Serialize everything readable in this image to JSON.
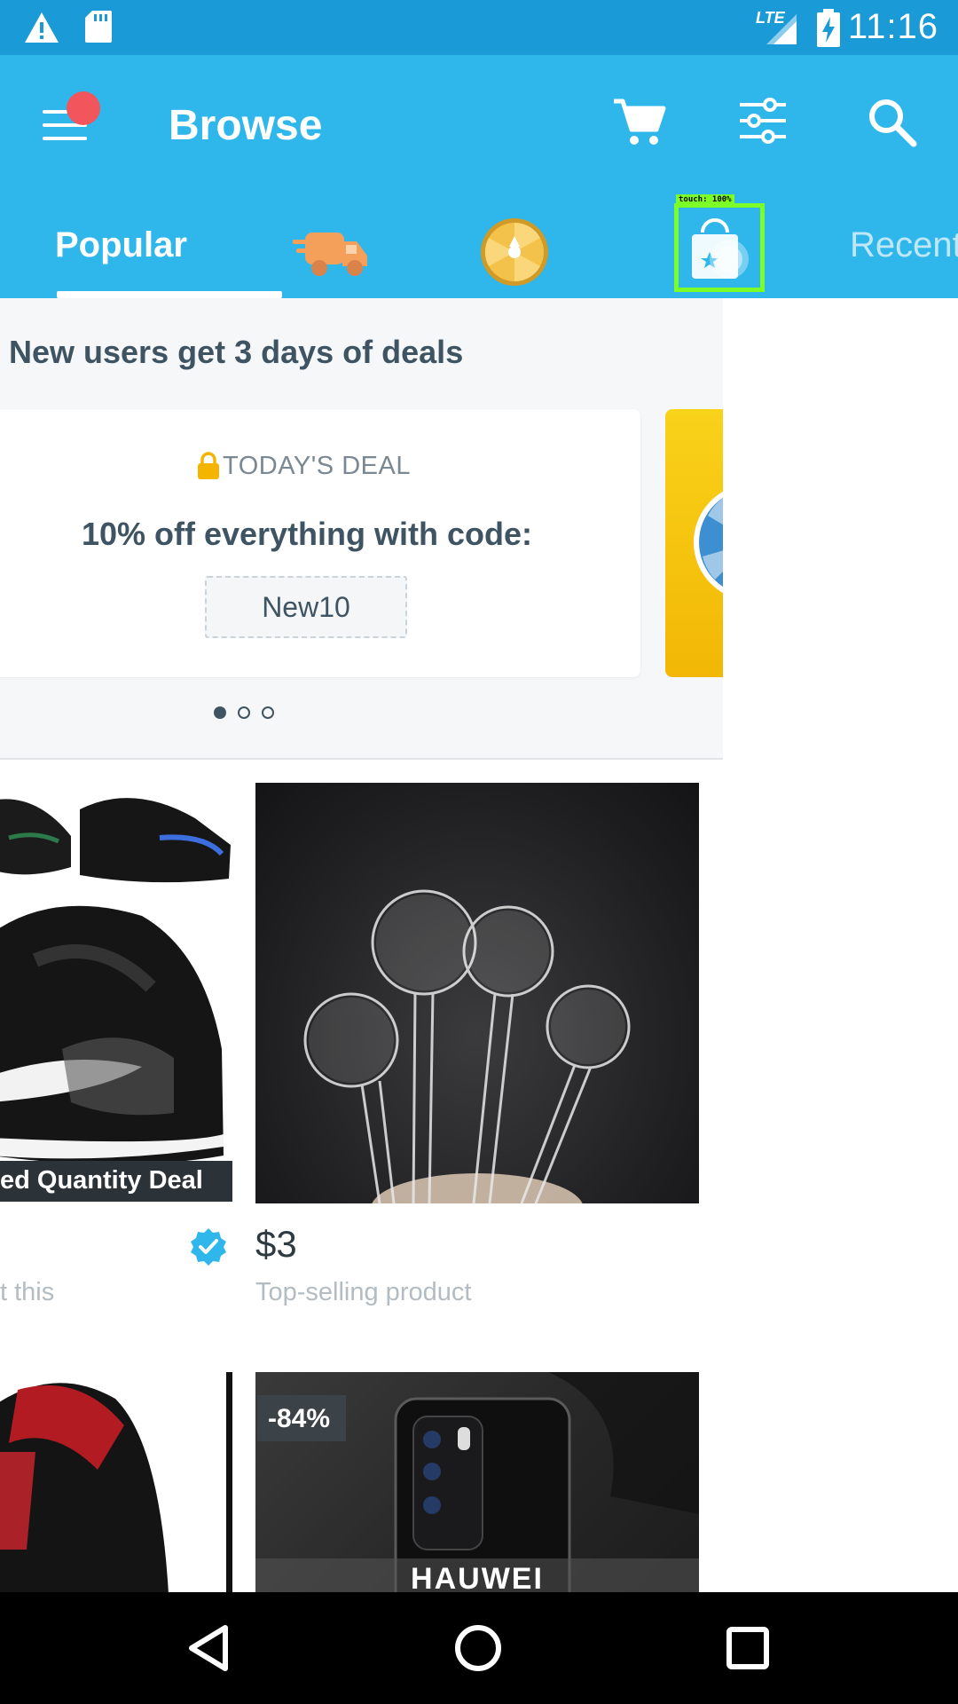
{
  "status_bar": {
    "time": "11:16",
    "network": "LTE"
  },
  "header": {
    "title": "Browse",
    "accent": "#2fb7ec",
    "notification_dot": "#f2555c"
  },
  "tabs": [
    {
      "label": "Popular",
      "selected": true
    },
    {
      "icon": "delivery-truck-icon"
    },
    {
      "icon": "spin-wheel-icon"
    },
    {
      "icon": "shopping-bag-star-icon"
    },
    {
      "label": "Recent"
    }
  ],
  "touch_overlay": {
    "label": "touch: 100%"
  },
  "deals": {
    "heading": "New users get 3 days of deals",
    "kicker": "TODAY'S DEAL",
    "text": "10% off everything with code:",
    "code": "New10",
    "pages": 3,
    "active_page": 1
  },
  "products": [
    {
      "banner": "ed Quantity Deal",
      "subtext": "t this",
      "verified": true
    },
    {
      "price": "$3",
      "subtext": "Top-selling product"
    },
    {},
    {
      "discount": "-84%",
      "brand": "HAUWEI"
    }
  ]
}
